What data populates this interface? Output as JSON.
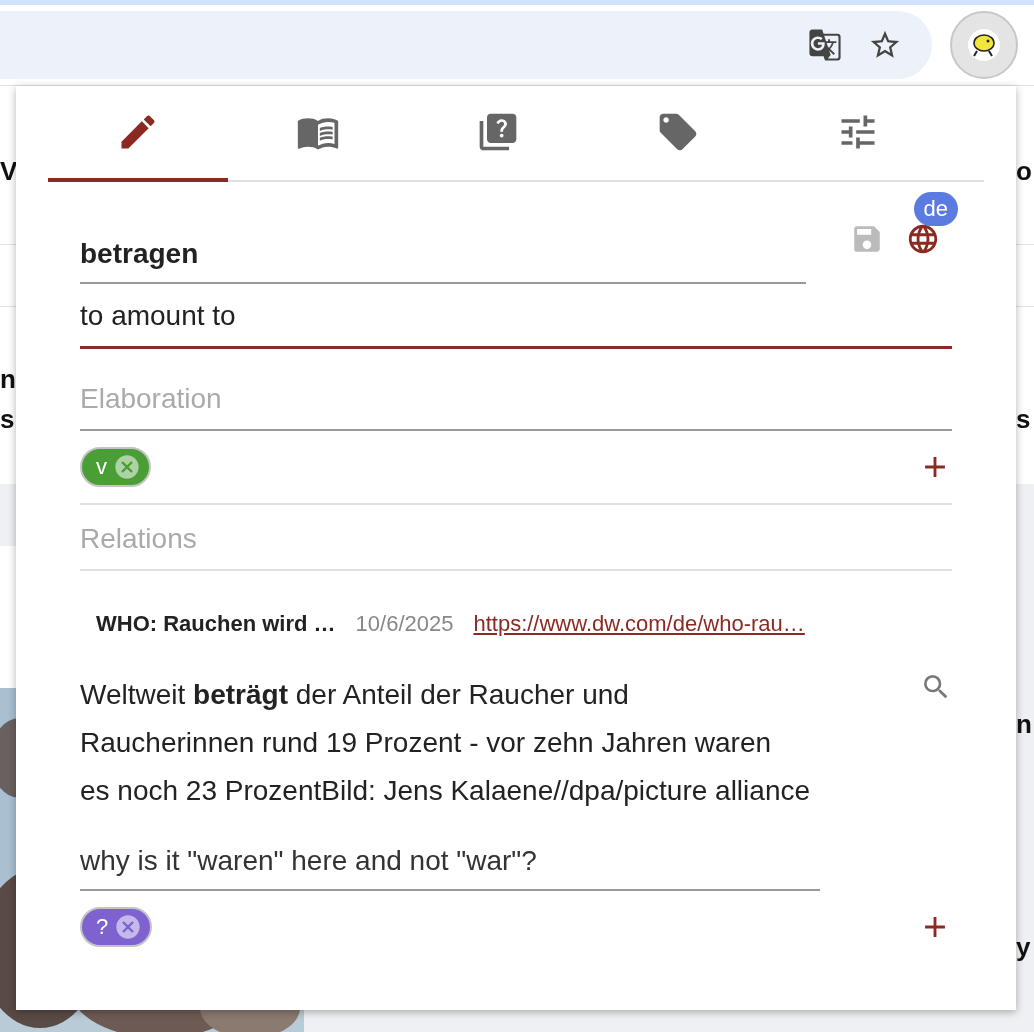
{
  "tabs": [
    {
      "kind": "edit",
      "selected": true
    },
    {
      "kind": "read",
      "selected": false
    },
    {
      "kind": "quiz",
      "selected": false
    },
    {
      "kind": "tags",
      "selected": false
    },
    {
      "kind": "settings",
      "selected": false
    }
  ],
  "entry": {
    "word": "betragen",
    "language": "de",
    "translation": "to amount to",
    "elaboration": {
      "placeholder": "Elaboration"
    },
    "tags": [
      {
        "label": "v",
        "color": "#4a9e35"
      }
    ],
    "relations": {
      "placeholder": "Relations"
    }
  },
  "source": {
    "title": "WHO: Rauchen wird …",
    "date": "10/6/2025",
    "url": "https://www.dw.com/de/who-rau…"
  },
  "context": "Weltweit **beträgt** der Anteil der Raucher und\nRaucherinnen rund 19 Prozent - vor zehn Jahren waren\nes noch 23 ProzentBild: Jens Kalaene//dpa/picture alliance",
  "note": {
    "value": "why is it \"waren\" here and not \"war\"?"
  },
  "note_tags": [
    {
      "label": "?",
      "color": "#7e62d0"
    }
  ],
  "background": {
    "left": [
      "V",
      "n",
      "s"
    ],
    "right": [
      "o",
      "s",
      "n",
      "y"
    ]
  }
}
